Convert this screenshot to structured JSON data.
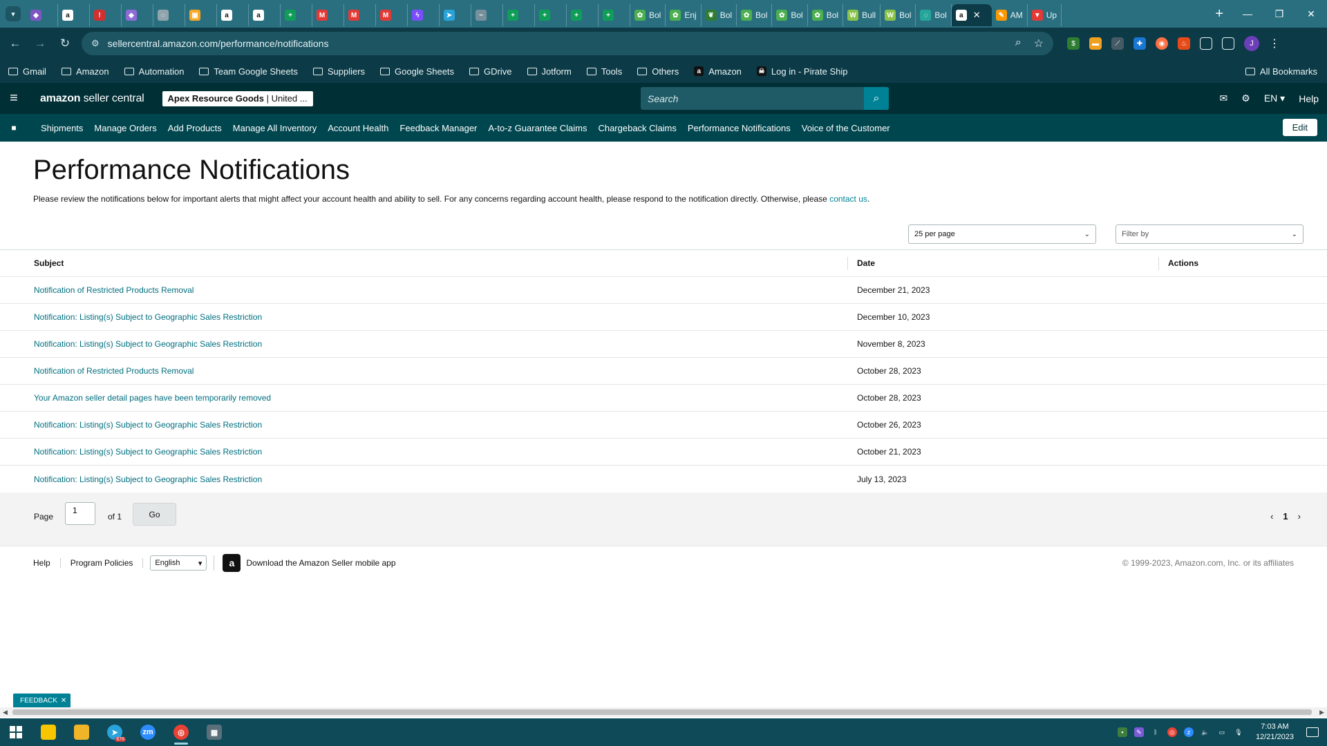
{
  "browser": {
    "tabs": [
      {
        "label": "",
        "icon": "extension-icon",
        "color": "#7e57c2"
      },
      {
        "label": "",
        "icon": "amazon-icon",
        "color": "#ffffff"
      },
      {
        "label": "",
        "icon": "alert-icon",
        "color": "#d32f2f"
      },
      {
        "label": "",
        "icon": "pin-icon",
        "color": "#8e6bd6"
      },
      {
        "label": "",
        "icon": "globe-icon",
        "color": "#90a4ae"
      },
      {
        "label": "",
        "icon": "note-icon",
        "color": "#f9a825"
      },
      {
        "label": "",
        "icon": "amazon-icon",
        "color": "#ffffff"
      },
      {
        "label": "",
        "icon": "amazon-icon",
        "color": "#ffffff"
      },
      {
        "label": "",
        "icon": "sheets-icon",
        "color": "#0f9d58"
      },
      {
        "label": "",
        "icon": "mail-icon",
        "color": "#e53935"
      },
      {
        "label": "",
        "icon": "mail-icon",
        "color": "#e53935"
      },
      {
        "label": "",
        "icon": "mail-icon",
        "color": "#e53935"
      },
      {
        "label": "",
        "icon": "messenger-icon",
        "color": "#7c4dff"
      },
      {
        "label": "",
        "icon": "telegram-icon",
        "color": "#29a3d9"
      },
      {
        "label": "",
        "icon": "chart-icon",
        "color": "#78909c"
      },
      {
        "label": "",
        "icon": "sheets-icon",
        "color": "#0f9d58"
      },
      {
        "label": "",
        "icon": "sheets-icon",
        "color": "#0f9d58"
      },
      {
        "label": "",
        "icon": "sheets-icon",
        "color": "#0f9d58"
      },
      {
        "label": "",
        "icon": "sheets-icon",
        "color": "#0f9d58"
      },
      {
        "label": "Bol",
        "icon": "plant-icon",
        "color": "#4caf50"
      },
      {
        "label": "Enj",
        "icon": "plant-icon",
        "color": "#4caf50"
      },
      {
        "label": "Bol",
        "icon": "leaf-icon",
        "color": "#2e7d32"
      },
      {
        "label": "Bol",
        "icon": "plant-icon",
        "color": "#4caf50"
      },
      {
        "label": "Bol",
        "icon": "plant-icon",
        "color": "#4caf50"
      },
      {
        "label": "Bol",
        "icon": "plant-icon",
        "color": "#4caf50"
      },
      {
        "label": "Bull",
        "icon": "w-icon",
        "color": "#8bc34a"
      },
      {
        "label": "Bol",
        "icon": "w-icon",
        "color": "#8bc34a"
      },
      {
        "label": "Bol",
        "icon": "globe-icon",
        "color": "#26a69a"
      },
      {
        "label": "",
        "icon": "amazon-icon",
        "color": "#ffffff",
        "active": true
      },
      {
        "label": "AM",
        "icon": "pencil-icon",
        "color": "#ff9800"
      },
      {
        "label": "Up",
        "icon": "shield-icon",
        "color": "#e53935"
      }
    ],
    "url": "sellercentral.amazon.com/performance/notifications",
    "bookmarks": [
      "Gmail",
      "Amazon",
      "Automation",
      "Team Google Sheets",
      "Suppliers",
      "Google Sheets",
      "GDrive",
      "Jotform",
      "Tools",
      "Others"
    ],
    "bookmark_links": [
      {
        "label": "Amazon",
        "icon": "amazon-icon"
      },
      {
        "label": "Log in - Pirate Ship",
        "icon": "pirate-icon"
      }
    ],
    "all_bookmarks": "All Bookmarks",
    "profile_initial": "J"
  },
  "header": {
    "logo_bold": "amazon",
    "logo_light": " seller central",
    "account_name": "Apex Resource Goods",
    "account_region": " | United ...",
    "search_placeholder": "Search",
    "language": "EN",
    "help": "Help"
  },
  "nav": {
    "items": [
      "Shipments",
      "Manage Orders",
      "Add Products",
      "Manage All Inventory",
      "Account Health",
      "Feedback Manager",
      "A-to-z Guarantee Claims",
      "Chargeback Claims",
      "Performance Notifications",
      "Voice of the Customer"
    ],
    "edit": "Edit"
  },
  "page": {
    "title": "Performance Notifications",
    "intro": "Please review the notifications below for important alerts that might affect your account health and ability to sell. For any concerns regarding account health, please respond to the notification directly. Otherwise, please ",
    "intro_link": "contact us",
    "intro_end": "."
  },
  "controls": {
    "per_page": "25 per page",
    "filter_placeholder": "Filter by"
  },
  "table": {
    "headers": {
      "subject": "Subject",
      "date": "Date",
      "actions": "Actions"
    },
    "rows": [
      {
        "subject": "Notification of Restricted Products Removal",
        "date": "December 21, 2023"
      },
      {
        "subject": "Notification: Listing(s) Subject to Geographic Sales Restriction",
        "date": "December 10, 2023"
      },
      {
        "subject": "Notification: Listing(s) Subject to Geographic Sales Restriction",
        "date": "November 8, 2023"
      },
      {
        "subject": "Notification of Restricted Products Removal",
        "date": "October 28, 2023"
      },
      {
        "subject": "Your Amazon seller detail pages have been temporarily removed",
        "date": "October 28, 2023"
      },
      {
        "subject": "Notification: Listing(s) Subject to Geographic Sales Restriction",
        "date": "October 26, 2023"
      },
      {
        "subject": "Notification: Listing(s) Subject to Geographic Sales Restriction",
        "date": "October 21, 2023"
      },
      {
        "subject": "Notification: Listing(s) Subject to Geographic Sales Restriction",
        "date": "July 13, 2023"
      }
    ]
  },
  "pagination": {
    "page_label": "Page",
    "page_value": "1",
    "of_label": "of 1",
    "go": "Go",
    "current": "1"
  },
  "footer": {
    "help": "Help",
    "policies": "Program Policies",
    "language": "English",
    "app_text": "Download the Amazon Seller mobile app",
    "copyright": "© 1999-2023, Amazon.com, Inc. or its affiliates"
  },
  "feedback": "FEEDBACK",
  "taskbar": {
    "apps": [
      {
        "name": "sticky-notes-icon",
        "color": "#f7c600",
        "glyph": ""
      },
      {
        "name": "file-explorer-icon",
        "color": "#f0b429",
        "glyph": ""
      },
      {
        "name": "telegram-icon",
        "color": "#2aa3dc",
        "glyph": "➤",
        "badge": "676"
      },
      {
        "name": "zoom-icon",
        "color": "#2d8cff",
        "glyph": "zm"
      },
      {
        "name": "chrome-icon",
        "color": "#e94235",
        "glyph": "◎",
        "active": true
      },
      {
        "name": "calculator-icon",
        "color": "#5a6f7a",
        "glyph": "▦"
      }
    ],
    "time": "7:03 AM",
    "date": "12/21/2023"
  }
}
